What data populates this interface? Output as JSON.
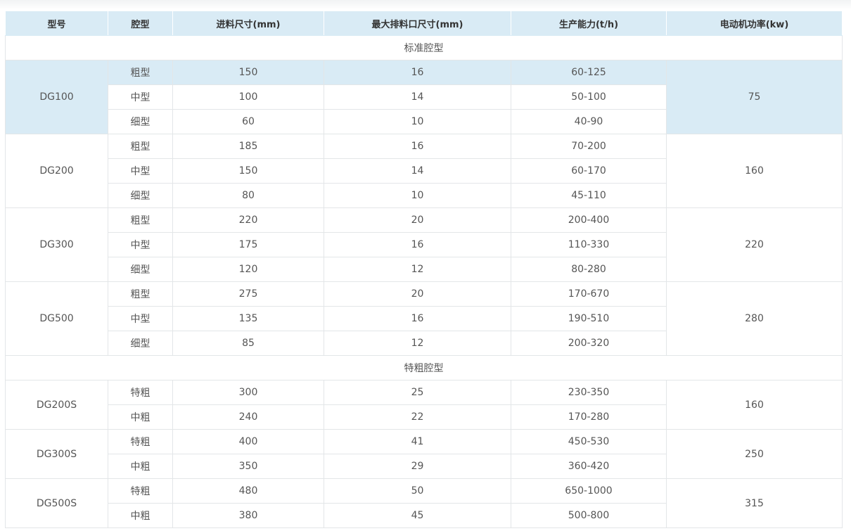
{
  "table": {
    "headers": [
      "型号",
      "腔型",
      "进料尺寸(mm)",
      "最大排料口尺寸(mm)",
      "生产能力(t/h)",
      "电动机功率(kw)"
    ],
    "sections": [
      {
        "title": "标准腔型",
        "models": [
          {
            "model": "DG100",
            "power": "75",
            "highlight": true,
            "rows": [
              {
                "cavity": "粗型",
                "feed": "150",
                "discharge": "16",
                "capacity": "60-125"
              },
              {
                "cavity": "中型",
                "feed": "100",
                "discharge": "14",
                "capacity": "50-100"
              },
              {
                "cavity": "细型",
                "feed": "60",
                "discharge": "10",
                "capacity": "40-90"
              }
            ]
          },
          {
            "model": "DG200",
            "power": "160",
            "rows": [
              {
                "cavity": "粗型",
                "feed": "185",
                "discharge": "16",
                "capacity": "70-200"
              },
              {
                "cavity": "中型",
                "feed": "150",
                "discharge": "14",
                "capacity": "60-170"
              },
              {
                "cavity": "细型",
                "feed": "80",
                "discharge": "10",
                "capacity": "45-110"
              }
            ]
          },
          {
            "model": "DG300",
            "power": "220",
            "rows": [
              {
                "cavity": "粗型",
                "feed": "220",
                "discharge": "20",
                "capacity": "200-400"
              },
              {
                "cavity": "中型",
                "feed": "175",
                "discharge": "16",
                "capacity": "110-330"
              },
              {
                "cavity": "细型",
                "feed": "120",
                "discharge": "12",
                "capacity": "80-280"
              }
            ]
          },
          {
            "model": "DG500",
            "power": "280",
            "rows": [
              {
                "cavity": "粗型",
                "feed": "275",
                "discharge": "20",
                "capacity": "170-670"
              },
              {
                "cavity": "中型",
                "feed": "135",
                "discharge": "16",
                "capacity": "190-510"
              },
              {
                "cavity": "细型",
                "feed": "85",
                "discharge": "12",
                "capacity": "200-320"
              }
            ]
          }
        ]
      },
      {
        "title": "特粗腔型",
        "models": [
          {
            "model": "DG200S",
            "power": "160",
            "rows": [
              {
                "cavity": "特粗",
                "feed": "300",
                "discharge": "25",
                "capacity": "230-350"
              },
              {
                "cavity": "中粗",
                "feed": "240",
                "discharge": "22",
                "capacity": "170-280"
              }
            ]
          },
          {
            "model": "DG300S",
            "power": "250",
            "rows": [
              {
                "cavity": "特粗",
                "feed": "400",
                "discharge": "41",
                "capacity": "450-530"
              },
              {
                "cavity": "中粗",
                "feed": "350",
                "discharge": "29",
                "capacity": "360-420"
              }
            ]
          },
          {
            "model": "DG500S",
            "power": "315",
            "rows": [
              {
                "cavity": "特粗",
                "feed": "480",
                "discharge": "50",
                "capacity": "650-1000"
              },
              {
                "cavity": "中粗",
                "feed": "380",
                "discharge": "45",
                "capacity": "500-800"
              }
            ]
          }
        ]
      }
    ]
  },
  "colors": {
    "header_bg": "#d9ebf5",
    "highlight_bg": "#d9ebf5",
    "border": "#e3e6e8",
    "text": "#555555"
  }
}
